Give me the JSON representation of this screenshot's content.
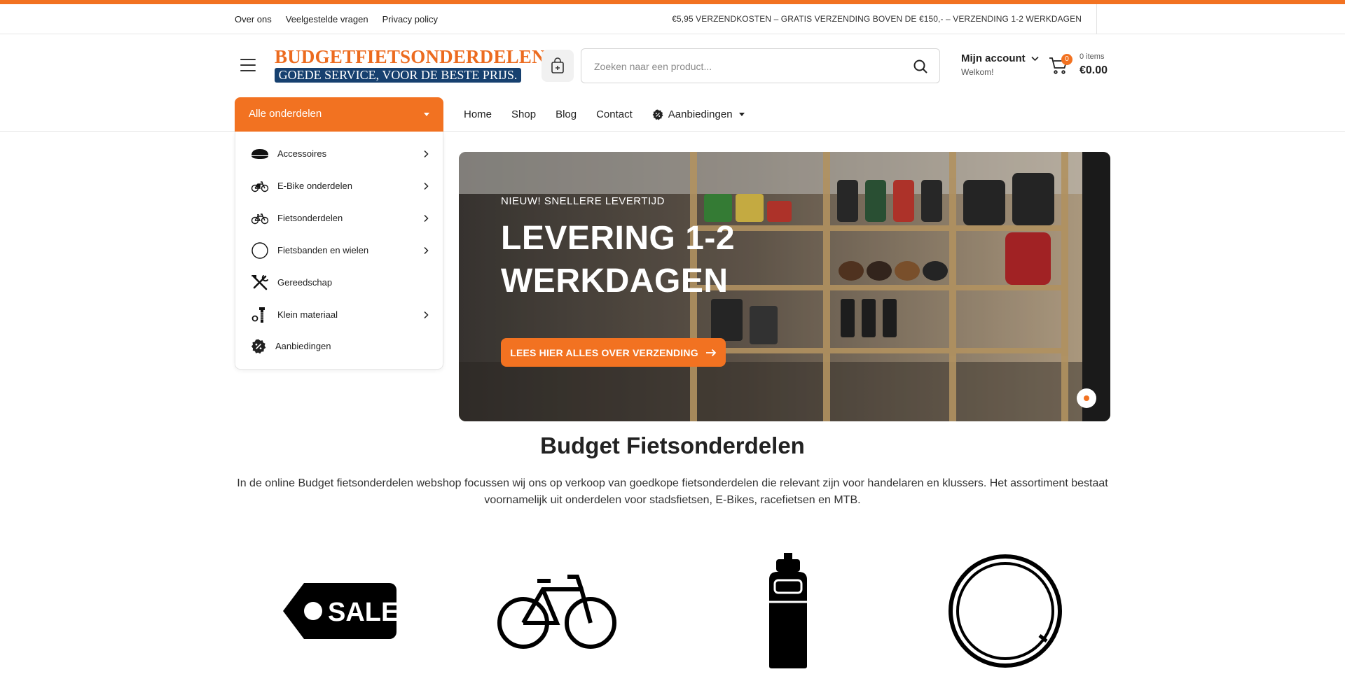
{
  "brand": {
    "accent": "#f27221",
    "navy": "#16406f",
    "logo_top": "BUDGETFIETSONDERDELEN",
    "logo_bottom": "GOEDE SERVICE, VOOR DE BESTE PRIJS."
  },
  "utility": {
    "links": [
      "Over ons",
      "Veelgestelde vragen",
      "Privacy policy"
    ],
    "notice": "€5,95 VERZENDKOSTEN – GRATIS VERZENDING BOVEN DE €150,- – VERZENDING 1-2 WERKDAGEN"
  },
  "header": {
    "search_placeholder": "Zoeken naar een product...",
    "account_title": "Mijn account",
    "account_sub": "Welkom!",
    "cart_count": "0",
    "cart_items": "0 items",
    "cart_total": "€0.00"
  },
  "nav": {
    "all_parts": "Alle onderdelen",
    "items": [
      "Home",
      "Shop",
      "Blog",
      "Contact"
    ],
    "deals": "Aanbiedingen"
  },
  "categories": [
    {
      "label": "Accessoires",
      "icon": "helmet-icon",
      "has_children": true
    },
    {
      "label": "E-Bike onderdelen",
      "icon": "ebike-icon",
      "has_children": true
    },
    {
      "label": "Fietsonderdelen",
      "icon": "bicycle-icon",
      "has_children": true
    },
    {
      "label": "Fietsbanden en wielen",
      "icon": "tire-icon",
      "has_children": true
    },
    {
      "label": "Gereedschap",
      "icon": "tools-icon",
      "has_children": false
    },
    {
      "label": "Klein materiaal",
      "icon": "bolt-icon",
      "has_children": true
    },
    {
      "label": "Aanbiedingen",
      "icon": "discount-badge-icon",
      "has_children": false
    }
  ],
  "hero": {
    "eyebrow": "NIEUW! SNELLERE LEVERTIJD",
    "title_line1": "LEVERING 1-2",
    "title_line2": "WERKDAGEN",
    "cta": "LEES HIER ALLES OVER VERZENDING"
  },
  "intro": {
    "title": "Budget Fietsonderdelen",
    "text": "In de online Budget fietsonderdelen webshop focussen wij ons op verkoop van goedkope fietsonderdelen die relevant zijn voor handelaren en klussers. Het assortiment bestaat voornamelijk uit onderdelen voor stadsfietsen, E-Bikes, racefietsen en MTB."
  },
  "tiles": [
    {
      "icon": "sale-tag-icon",
      "text": "SALE"
    },
    {
      "icon": "bicycle-icon"
    },
    {
      "icon": "water-bottle-icon"
    },
    {
      "icon": "tire-icon"
    }
  ]
}
